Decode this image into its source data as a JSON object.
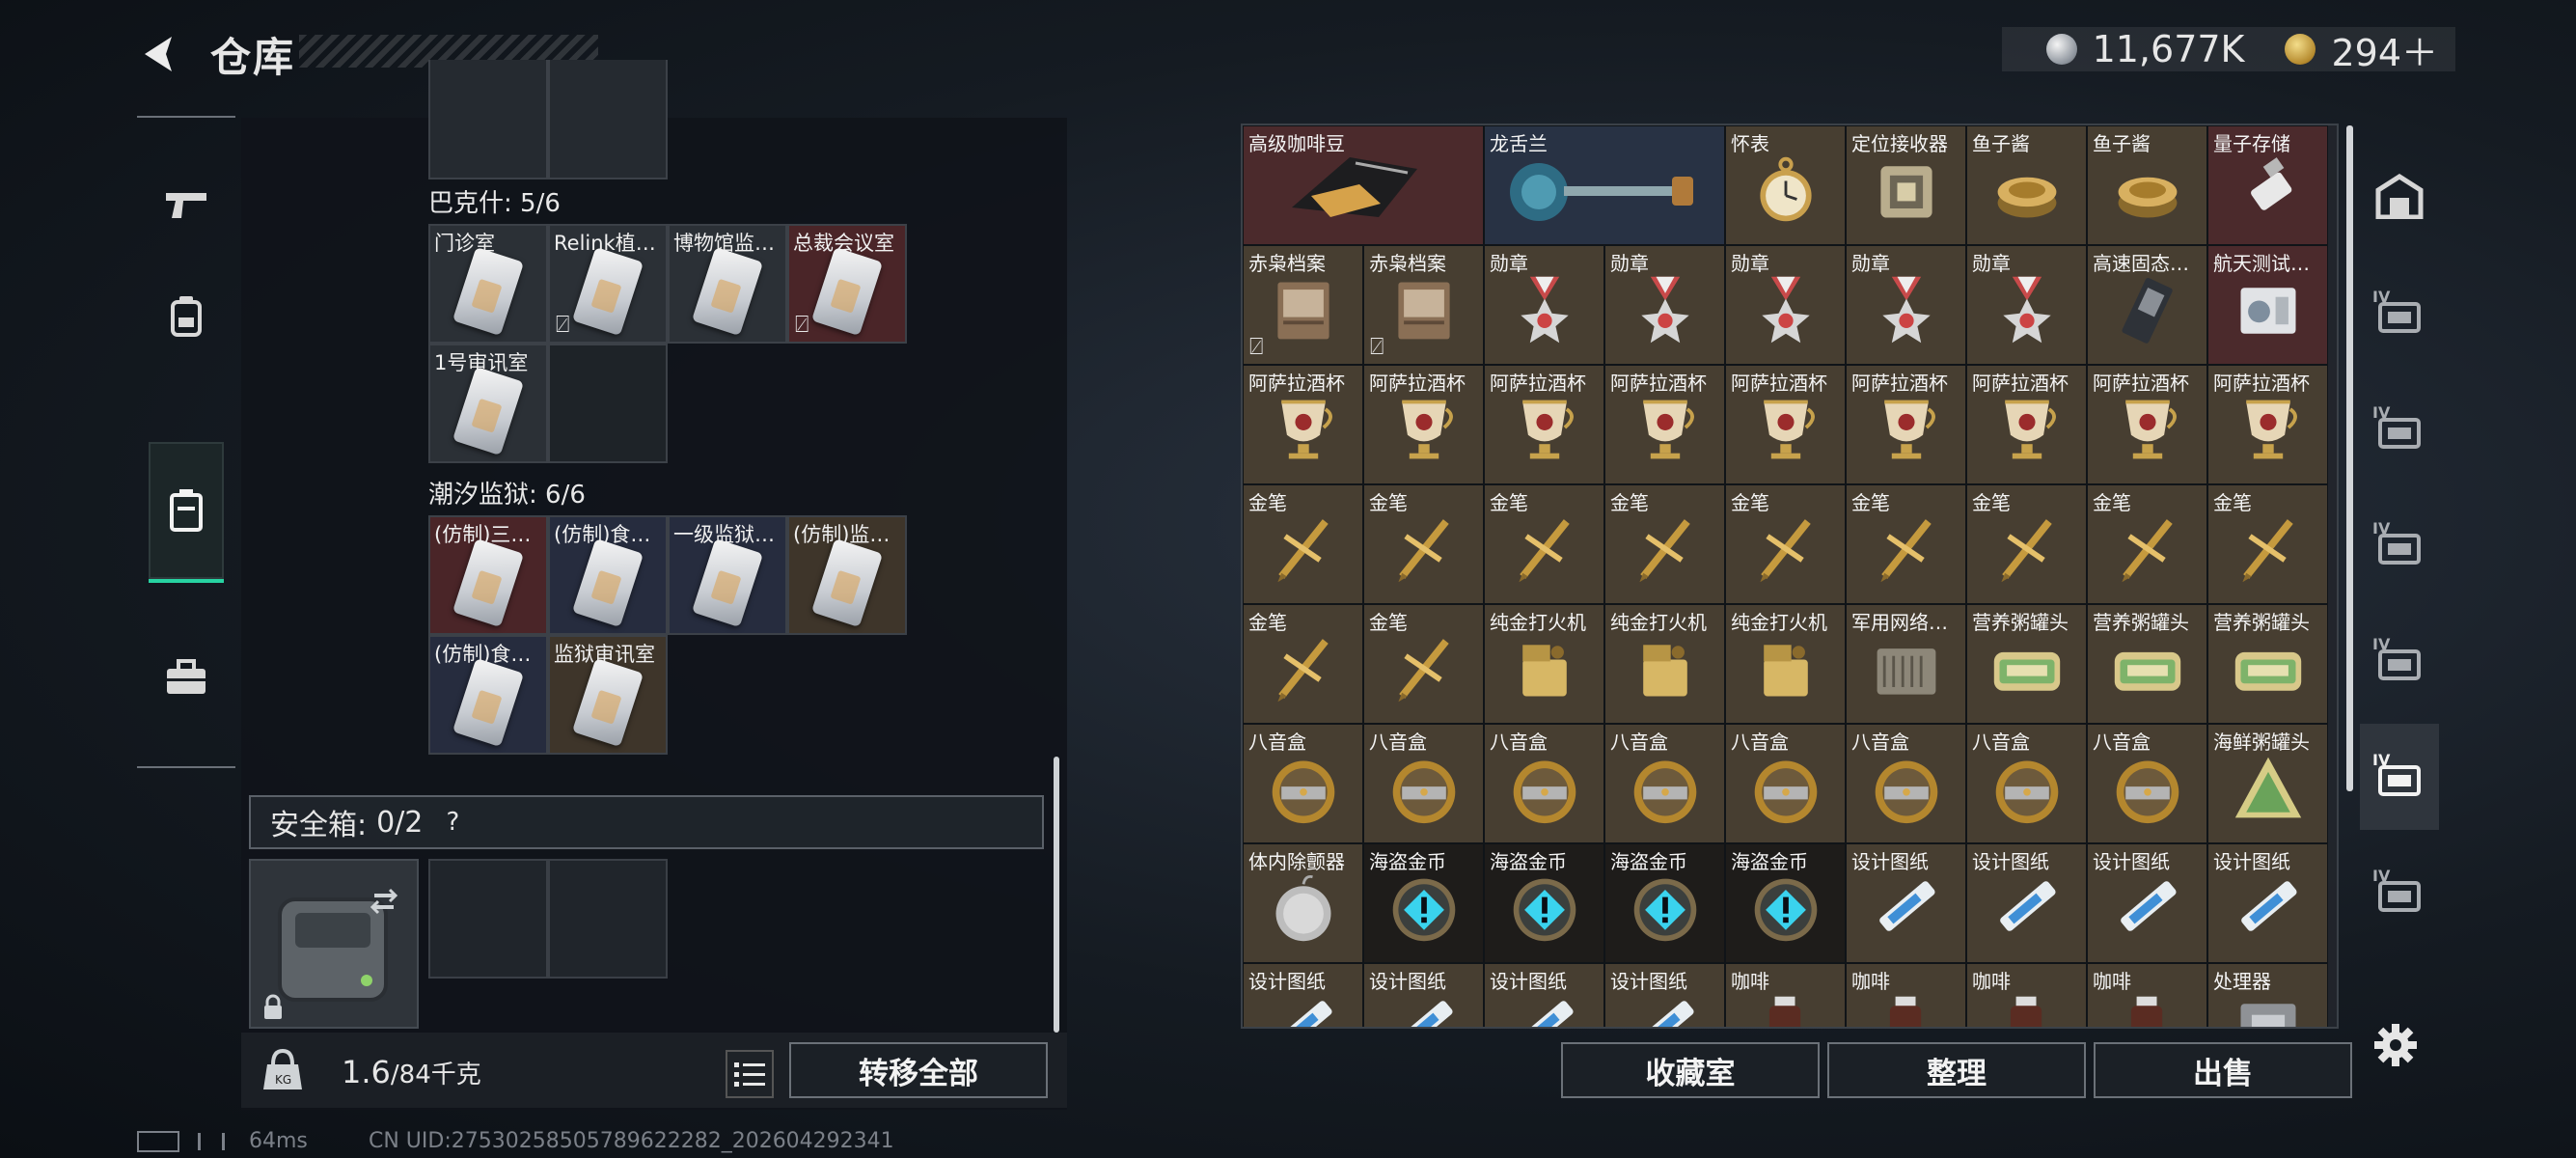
{
  "header": {
    "title": "仓库",
    "currency_main": "11,677K",
    "currency_premium": "294＋"
  },
  "left_nav": {
    "items": [
      {
        "name": "weapons",
        "icon": "pistol-icon"
      },
      {
        "name": "armor",
        "icon": "backpack-icon"
      },
      {
        "name": "containers",
        "icon": "box-icon",
        "active": true
      },
      {
        "name": "kits",
        "icon": "toolbox-icon"
      }
    ]
  },
  "keys": {
    "groups": [
      {
        "label": "巴克什: 5/6",
        "items": [
          {
            "label": "门诊室",
            "color": "grey",
            "nosell": false
          },
          {
            "label": "Relink植…",
            "color": "grey",
            "nosell": true
          },
          {
            "label": "博物馆监…",
            "color": "grey",
            "nosell": false
          },
          {
            "label": "总裁会议室",
            "color": "red",
            "nosell": true
          },
          {
            "label": "1号审讯室",
            "color": "grey",
            "nosell": false
          }
        ]
      },
      {
        "label": "潮汐监狱: 6/6",
        "items": [
          {
            "label": "(仿制)三…",
            "color": "red",
            "nosell": false
          },
          {
            "label": "(仿制)食…",
            "color": "blue",
            "nosell": false
          },
          {
            "label": "一级监狱…",
            "color": "blue",
            "nosell": false
          },
          {
            "label": "(仿制)监…",
            "color": "gold",
            "nosell": false
          },
          {
            "label": "(仿制)食…",
            "color": "blue",
            "nosell": false
          },
          {
            "label": "监狱审讯室",
            "color": "gold",
            "nosell": false
          }
        ]
      }
    ]
  },
  "safe_box": {
    "label": "安全箱:",
    "count": "0/2",
    "help": "?"
  },
  "footer_left": {
    "weight_current": "1.6",
    "weight_max": "/84千克",
    "transfer_all": "转移全部"
  },
  "inventory": {
    "rows": [
      [
        {
          "label": "高级咖啡豆",
          "bg": "red",
          "icon": "coffee-bag-icon",
          "w": 2
        },
        {
          "label": "龙舌兰",
          "bg": "blue",
          "icon": "bottle-icon",
          "w": 2
        },
        {
          "label": "怀表",
          "bg": "gold",
          "icon": "pocket-watch-icon"
        },
        {
          "label": "定位接收器",
          "bg": "gold",
          "icon": "receiver-icon"
        },
        {
          "label": "鱼子酱",
          "bg": "gold",
          "icon": "caviar-icon"
        },
        {
          "label": "鱼子酱",
          "bg": "gold",
          "icon": "caviar-icon"
        },
        {
          "label": "量子存储",
          "bg": "red",
          "icon": "usb-icon"
        }
      ],
      [
        {
          "label": "赤枭档案",
          "bg": "gold",
          "icon": "dossier-icon",
          "nosell": true
        },
        {
          "label": "赤枭档案",
          "bg": "gold",
          "icon": "dossier-icon",
          "nosell": true
        },
        {
          "label": "勋章",
          "bg": "gold",
          "icon": "medal-icon"
        },
        {
          "label": "勋章",
          "bg": "gold",
          "icon": "medal-icon"
        },
        {
          "label": "勋章",
          "bg": "gold",
          "icon": "medal-icon"
        },
        {
          "label": "勋章",
          "bg": "gold",
          "icon": "medal-icon"
        },
        {
          "label": "勋章",
          "bg": "gold",
          "icon": "medal-icon"
        },
        {
          "label": "高速固态…",
          "bg": "gold",
          "icon": "ssd-icon"
        },
        {
          "label": "航天测试…",
          "bg": "red",
          "icon": "device-icon"
        }
      ],
      [
        {
          "label": "阿萨拉酒杯",
          "bg": "gold",
          "icon": "goblet-icon"
        },
        {
          "label": "阿萨拉酒杯",
          "bg": "gold",
          "icon": "goblet-icon"
        },
        {
          "label": "阿萨拉酒杯",
          "bg": "gold",
          "icon": "goblet-icon"
        },
        {
          "label": "阿萨拉酒杯",
          "bg": "gold",
          "icon": "goblet-icon"
        },
        {
          "label": "阿萨拉酒杯",
          "bg": "gold",
          "icon": "goblet-icon"
        },
        {
          "label": "阿萨拉酒杯",
          "bg": "gold",
          "icon": "goblet-icon"
        },
        {
          "label": "阿萨拉酒杯",
          "bg": "gold",
          "icon": "goblet-icon"
        },
        {
          "label": "阿萨拉酒杯",
          "bg": "gold",
          "icon": "goblet-icon"
        },
        {
          "label": "阿萨拉酒杯",
          "bg": "gold",
          "icon": "goblet-icon"
        }
      ],
      [
        {
          "label": "金笔",
          "bg": "gold",
          "icon": "gold-pen-icon"
        },
        {
          "label": "金笔",
          "bg": "gold",
          "icon": "gold-pen-icon"
        },
        {
          "label": "金笔",
          "bg": "gold",
          "icon": "gold-pen-icon"
        },
        {
          "label": "金笔",
          "bg": "gold",
          "icon": "gold-pen-icon"
        },
        {
          "label": "金笔",
          "bg": "gold",
          "icon": "gold-pen-icon"
        },
        {
          "label": "金笔",
          "bg": "gold",
          "icon": "gold-pen-icon"
        },
        {
          "label": "金笔",
          "bg": "gold",
          "icon": "gold-pen-icon"
        },
        {
          "label": "金笔",
          "bg": "gold",
          "icon": "gold-pen-icon"
        },
        {
          "label": "金笔",
          "bg": "gold",
          "icon": "gold-pen-icon"
        }
      ],
      [
        {
          "label": "金笔",
          "bg": "gold",
          "icon": "gold-pen-icon"
        },
        {
          "label": "金笔",
          "bg": "gold",
          "icon": "gold-pen-icon"
        },
        {
          "label": "纯金打火机",
          "bg": "gold",
          "icon": "lighter-icon"
        },
        {
          "label": "纯金打火机",
          "bg": "gold",
          "icon": "lighter-icon"
        },
        {
          "label": "纯金打火机",
          "bg": "gold",
          "icon": "lighter-icon"
        },
        {
          "label": "军用网络…",
          "bg": "gold",
          "icon": "network-box-icon"
        },
        {
          "label": "营养粥罐头",
          "bg": "gold",
          "icon": "can-icon"
        },
        {
          "label": "营养粥罐头",
          "bg": "gold",
          "icon": "can-icon"
        },
        {
          "label": "营养粥罐头",
          "bg": "gold",
          "icon": "can-icon"
        }
      ],
      [
        {
          "label": "八音盒",
          "bg": "gold",
          "icon": "music-box-icon"
        },
        {
          "label": "八音盒",
          "bg": "gold",
          "icon": "music-box-icon"
        },
        {
          "label": "八音盒",
          "bg": "gold",
          "icon": "music-box-icon"
        },
        {
          "label": "八音盒",
          "bg": "gold",
          "icon": "music-box-icon"
        },
        {
          "label": "八音盒",
          "bg": "gold",
          "icon": "music-box-icon"
        },
        {
          "label": "八音盒",
          "bg": "gold",
          "icon": "music-box-icon"
        },
        {
          "label": "八音盒",
          "bg": "gold",
          "icon": "music-box-icon"
        },
        {
          "label": "八音盒",
          "bg": "gold",
          "icon": "music-box-icon"
        },
        {
          "label": "海鲜粥罐头",
          "bg": "gold",
          "icon": "triangle-can-icon"
        }
      ],
      [
        {
          "label": "体内除颤器",
          "bg": "gold",
          "icon": "defibrillator-icon"
        },
        {
          "label": "海盗金币",
          "bg": "dark",
          "icon": "pirate-coin-icon"
        },
        {
          "label": "海盗金币",
          "bg": "dark",
          "icon": "pirate-coin-icon"
        },
        {
          "label": "海盗金币",
          "bg": "dark",
          "icon": "pirate-coin-icon"
        },
        {
          "label": "海盗金币",
          "bg": "dark",
          "icon": "pirate-coin-icon"
        },
        {
          "label": "设计图纸",
          "bg": "gold",
          "icon": "blueprint-icon"
        },
        {
          "label": "设计图纸",
          "bg": "gold",
          "icon": "blueprint-icon"
        },
        {
          "label": "设计图纸",
          "bg": "gold",
          "icon": "blueprint-icon"
        },
        {
          "label": "设计图纸",
          "bg": "gold",
          "icon": "blueprint-icon"
        }
      ],
      [
        {
          "label": "设计图纸",
          "bg": "gold",
          "icon": "blueprint-icon"
        },
        {
          "label": "设计图纸",
          "bg": "gold",
          "icon": "blueprint-icon"
        },
        {
          "label": "设计图纸",
          "bg": "gold",
          "icon": "blueprint-icon"
        },
        {
          "label": "设计图纸",
          "bg": "gold",
          "icon": "blueprint-icon"
        },
        {
          "label": "咖啡",
          "bg": "gold",
          "icon": "coffee-bottle-icon"
        },
        {
          "label": "咖啡",
          "bg": "gold",
          "icon": "coffee-bottle-icon"
        },
        {
          "label": "咖啡",
          "bg": "gold",
          "icon": "coffee-bottle-icon"
        },
        {
          "label": "咖啡",
          "bg": "gold",
          "icon": "coffee-bottle-icon"
        },
        {
          "label": "处理器",
          "bg": "gold",
          "icon": "processor-icon"
        }
      ]
    ]
  },
  "footer_right": {
    "collection": "收藏室",
    "sort": "整理",
    "sell": "出售"
  },
  "right_nav": {
    "items": [
      {
        "name": "all",
        "icon": "storage-icon"
      },
      {
        "name": "tab-1",
        "icon": "folder-icon",
        "tier": "IV"
      },
      {
        "name": "tab-2",
        "icon": "medkit-icon",
        "tier": "IV"
      },
      {
        "name": "tab-3",
        "icon": "gun-case-icon",
        "tier": "IV"
      },
      {
        "name": "tab-4",
        "icon": "gun-case-icon",
        "tier": "IV"
      },
      {
        "name": "tab-5",
        "icon": "camera-icon",
        "tier": "IV",
        "active": true
      },
      {
        "name": "tab-6",
        "icon": "tool-icon",
        "tier": "IV"
      }
    ]
  },
  "status": {
    "ping": "64ms",
    "uid": "CN UID:27530258505789622282_202604292341"
  },
  "colors": {
    "accent": "#27d3a2",
    "gold_bg": "#473e31",
    "red_bg": "#4b2a2c",
    "blue_bg": "#283244"
  }
}
